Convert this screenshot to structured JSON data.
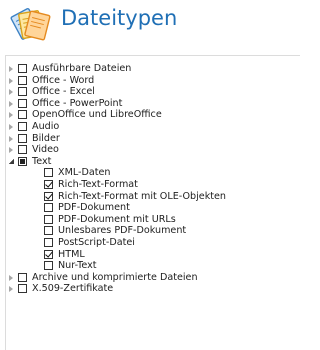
{
  "header": {
    "title": "Dateitypen",
    "logo_icon": "files-icon"
  },
  "tree": [
    {
      "id": "executables",
      "label": "Ausführbare Dateien",
      "level": 0,
      "expander": "collapsed",
      "state": "unchecked"
    },
    {
      "id": "office-word",
      "label": "Office - Word",
      "level": 0,
      "expander": "collapsed",
      "state": "unchecked"
    },
    {
      "id": "office-excel",
      "label": "Office - Excel",
      "level": 0,
      "expander": "collapsed",
      "state": "unchecked"
    },
    {
      "id": "office-powerpoint",
      "label": "Office - PowerPoint",
      "level": 0,
      "expander": "collapsed",
      "state": "unchecked"
    },
    {
      "id": "openoffice",
      "label": "OpenOffice und LibreOffice",
      "level": 0,
      "expander": "collapsed",
      "state": "unchecked"
    },
    {
      "id": "audio",
      "label": "Audio",
      "level": 0,
      "expander": "collapsed",
      "state": "unchecked"
    },
    {
      "id": "images",
      "label": "Bilder",
      "level": 0,
      "expander": "collapsed",
      "state": "unchecked"
    },
    {
      "id": "video",
      "label": "Video",
      "level": 0,
      "expander": "collapsed",
      "state": "unchecked"
    },
    {
      "id": "text",
      "label": "Text",
      "level": 0,
      "expander": "expanded",
      "state": "partial"
    },
    {
      "id": "xml",
      "label": "XML-Daten",
      "level": 1,
      "expander": "none",
      "state": "unchecked"
    },
    {
      "id": "rtf",
      "label": "Rich-Text-Format",
      "level": 1,
      "expander": "none",
      "state": "checked"
    },
    {
      "id": "rtf-ole",
      "label": "Rich-Text-Format mit OLE-Objekten",
      "level": 1,
      "expander": "none",
      "state": "checked"
    },
    {
      "id": "pdf",
      "label": "PDF-Dokument",
      "level": 1,
      "expander": "none",
      "state": "unchecked"
    },
    {
      "id": "pdf-urls",
      "label": "PDF-Dokument mit URLs",
      "level": 1,
      "expander": "none",
      "state": "unchecked"
    },
    {
      "id": "pdf-unreadable",
      "label": "Unlesbares PDF-Dokument",
      "level": 1,
      "expander": "none",
      "state": "unchecked"
    },
    {
      "id": "postscript",
      "label": "PostScript-Datei",
      "level": 1,
      "expander": "none",
      "state": "unchecked"
    },
    {
      "id": "html",
      "label": "HTML",
      "level": 1,
      "expander": "none",
      "state": "checked"
    },
    {
      "id": "plaintext",
      "label": "Nur-Text",
      "level": 1,
      "expander": "none",
      "state": "unchecked"
    },
    {
      "id": "archives",
      "label": "Archive und komprimierte Dateien",
      "level": 0,
      "expander": "collapsed",
      "state": "unchecked"
    },
    {
      "id": "x509",
      "label": "X.509-Zertifikate",
      "level": 0,
      "expander": "collapsed",
      "state": "unchecked"
    }
  ],
  "colors": {
    "title": "#1f6fb5",
    "expander_collapsed": "#a6a6a6",
    "text": "#1e1e1e"
  }
}
